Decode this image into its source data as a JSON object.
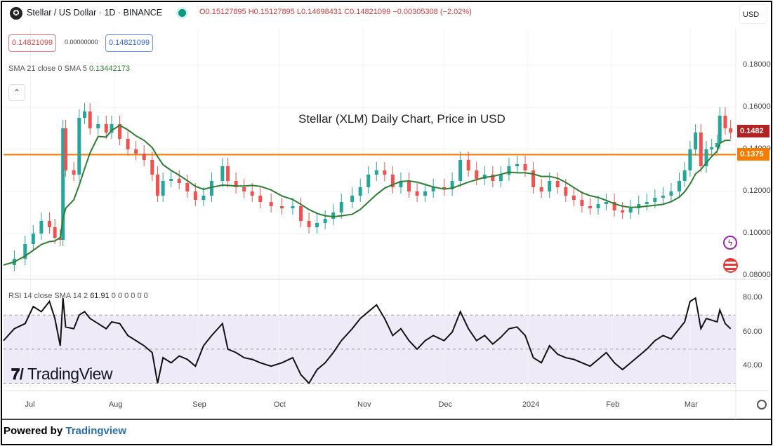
{
  "header": {
    "title": "Stellar / US Dollar · 1D · BINANCE",
    "open": "O0.15127895",
    "high": "H0.15127895",
    "low": "L0.14698431",
    "close": "C0.14821099",
    "change": "−0.00305308 (−2.02%)"
  },
  "trade": {
    "sell": "0.14821099",
    "spread": "0.00000000",
    "buy": "0.14821099"
  },
  "sma": {
    "label": "SMA 21 close 0 SMA 5",
    "value": "0.13442173"
  },
  "rsi": {
    "label": "RSI 14 close SMA 14 2",
    "value": "61.91",
    "extras": "0 0 0 0 0 0"
  },
  "currency": "USD",
  "annotation": "Stellar (XLM) Daily Chart, Price in USD",
  "price_tag": "0.1482",
  "level_tag": "0.1375",
  "logo": "TradingView",
  "footer": {
    "prefix": "Powered by",
    "brand": "Tradingview"
  },
  "colors": {
    "up": "#26a69a",
    "down": "#ef5350",
    "sma": "#2e7d32",
    "level": "#f57c00",
    "rsi": "#111111",
    "band": "#efeaf8"
  },
  "chart_data": {
    "type": "candlestick",
    "title": "Stellar (XLM) Daily Chart, Price in USD",
    "price_ticks": [
      "0.18000",
      "0.16000",
      "0.14000",
      "0.12000",
      "0.10000",
      "0.08000"
    ],
    "rsi_ticks": [
      "80.00",
      "60.00",
      "40.00"
    ],
    "time_ticks": [
      [
        "2023-07-01",
        "Jul"
      ],
      [
        "2023-08-01",
        "Aug"
      ],
      [
        "2023-09-01",
        "Sep"
      ],
      [
        "2023-10-01",
        "Oct"
      ],
      [
        "2023-11-01",
        "Nov"
      ],
      [
        "2023-12-01",
        "Dec"
      ],
      [
        "2024-01-01",
        "2024"
      ],
      [
        "2024-02-01",
        "Feb"
      ],
      [
        "2024-03-01",
        "Mar"
      ]
    ],
    "ylim": [
      0.08,
      0.18
    ],
    "rsi_ylim": [
      30,
      85
    ],
    "horizontal_level": 0.1375,
    "rows_date_close_rsi": [
      [
        "2023-06-21",
        0.085,
        55
      ],
      [
        "2023-06-25",
        0.088,
        62
      ],
      [
        "2023-06-29",
        0.095,
        65
      ],
      [
        "2023-07-02",
        0.1,
        75
      ],
      [
        "2023-07-05",
        0.106,
        72
      ],
      [
        "2023-07-08",
        0.103,
        78
      ],
      [
        "2023-07-10",
        0.098,
        68
      ],
      [
        "2023-07-12",
        0.097,
        52
      ],
      [
        "2023-07-13",
        0.15,
        80
      ],
      [
        "2023-07-14",
        0.13,
        63
      ],
      [
        "2023-07-17",
        0.128,
        62
      ],
      [
        "2023-07-19",
        0.155,
        70
      ],
      [
        "2023-07-21",
        0.158,
        72
      ],
      [
        "2023-07-23",
        0.15,
        68
      ],
      [
        "2023-07-26",
        0.152,
        65
      ],
      [
        "2023-07-29",
        0.148,
        62
      ],
      [
        "2023-07-31",
        0.152,
        66
      ],
      [
        "2023-08-03",
        0.145,
        65
      ],
      [
        "2023-08-06",
        0.14,
        58
      ],
      [
        "2023-08-09",
        0.138,
        55
      ],
      [
        "2023-08-12",
        0.135,
        52
      ],
      [
        "2023-08-15",
        0.128,
        48
      ],
      [
        "2023-08-17",
        0.118,
        30
      ],
      [
        "2023-08-19",
        0.125,
        45
      ],
      [
        "2023-08-22",
        0.126,
        42
      ],
      [
        "2023-08-25",
        0.124,
        46
      ],
      [
        "2023-08-28",
        0.12,
        44
      ],
      [
        "2023-08-31",
        0.116,
        40
      ],
      [
        "2023-09-03",
        0.118,
        52
      ],
      [
        "2023-09-06",
        0.125,
        58
      ],
      [
        "2023-09-10",
        0.132,
        65
      ],
      [
        "2023-09-12",
        0.125,
        50
      ],
      [
        "2023-09-15",
        0.122,
        48
      ],
      [
        "2023-09-18",
        0.12,
        45
      ],
      [
        "2023-09-21",
        0.118,
        44
      ],
      [
        "2023-09-24",
        0.115,
        42
      ],
      [
        "2023-09-28",
        0.113,
        40
      ],
      [
        "2023-10-02",
        0.112,
        42
      ],
      [
        "2023-10-06",
        0.113,
        45
      ],
      [
        "2023-10-09",
        0.106,
        35
      ],
      [
        "2023-10-12",
        0.103,
        30
      ],
      [
        "2023-10-15",
        0.105,
        38
      ],
      [
        "2023-10-18",
        0.107,
        42
      ],
      [
        "2023-10-21",
        0.11,
        48
      ],
      [
        "2023-10-24",
        0.115,
        55
      ],
      [
        "2023-10-28",
        0.118,
        62
      ],
      [
        "2023-10-31",
        0.122,
        68
      ],
      [
        "2023-11-03",
        0.128,
        72
      ],
      [
        "2023-11-06",
        0.13,
        76
      ],
      [
        "2023-11-09",
        0.128,
        68
      ],
      [
        "2023-11-12",
        0.122,
        58
      ],
      [
        "2023-11-15",
        0.125,
        62
      ],
      [
        "2023-11-18",
        0.12,
        55
      ],
      [
        "2023-11-21",
        0.118,
        50
      ],
      [
        "2023-11-24",
        0.12,
        55
      ],
      [
        "2023-11-27",
        0.122,
        58
      ],
      [
        "2023-12-01",
        0.121,
        55
      ],
      [
        "2023-12-04",
        0.125,
        60
      ],
      [
        "2023-12-07",
        0.135,
        72
      ],
      [
        "2023-12-10",
        0.13,
        62
      ],
      [
        "2023-12-13",
        0.126,
        55
      ],
      [
        "2023-12-16",
        0.128,
        58
      ],
      [
        "2023-12-19",
        0.125,
        53
      ],
      [
        "2023-12-22",
        0.128,
        57
      ],
      [
        "2023-12-25",
        0.132,
        62
      ],
      [
        "2023-12-28",
        0.133,
        63
      ],
      [
        "2023-12-31",
        0.13,
        58
      ],
      [
        "2024-01-03",
        0.122,
        45
      ],
      [
        "2024-01-06",
        0.12,
        42
      ],
      [
        "2024-01-09",
        0.125,
        52
      ],
      [
        "2024-01-12",
        0.122,
        47
      ],
      [
        "2024-01-15",
        0.118,
        45
      ],
      [
        "2024-01-18",
        0.116,
        44
      ],
      [
        "2024-01-21",
        0.113,
        42
      ],
      [
        "2024-01-24",
        0.112,
        40
      ],
      [
        "2024-01-27",
        0.114,
        44
      ],
      [
        "2024-01-30",
        0.115,
        48
      ],
      [
        "2024-02-02",
        0.111,
        42
      ],
      [
        "2024-02-05",
        0.11,
        38
      ],
      [
        "2024-02-08",
        0.112,
        42
      ],
      [
        "2024-02-11",
        0.114,
        46
      ],
      [
        "2024-02-14",
        0.115,
        50
      ],
      [
        "2024-02-17",
        0.117,
        55
      ],
      [
        "2024-02-20",
        0.118,
        58
      ],
      [
        "2024-02-23",
        0.12,
        56
      ],
      [
        "2024-02-26",
        0.125,
        62
      ],
      [
        "2024-02-28",
        0.13,
        66
      ],
      [
        "2024-03-01",
        0.14,
        78
      ],
      [
        "2024-03-03",
        0.148,
        80
      ],
      [
        "2024-03-05",
        0.132,
        62
      ],
      [
        "2024-03-07",
        0.14,
        68
      ],
      [
        "2024-03-09",
        0.141,
        67
      ],
      [
        "2024-03-11",
        0.143,
        66
      ],
      [
        "2024-03-12",
        0.156,
        73
      ],
      [
        "2024-03-14",
        0.15,
        65
      ],
      [
        "2024-03-16",
        0.148,
        62
      ]
    ]
  }
}
